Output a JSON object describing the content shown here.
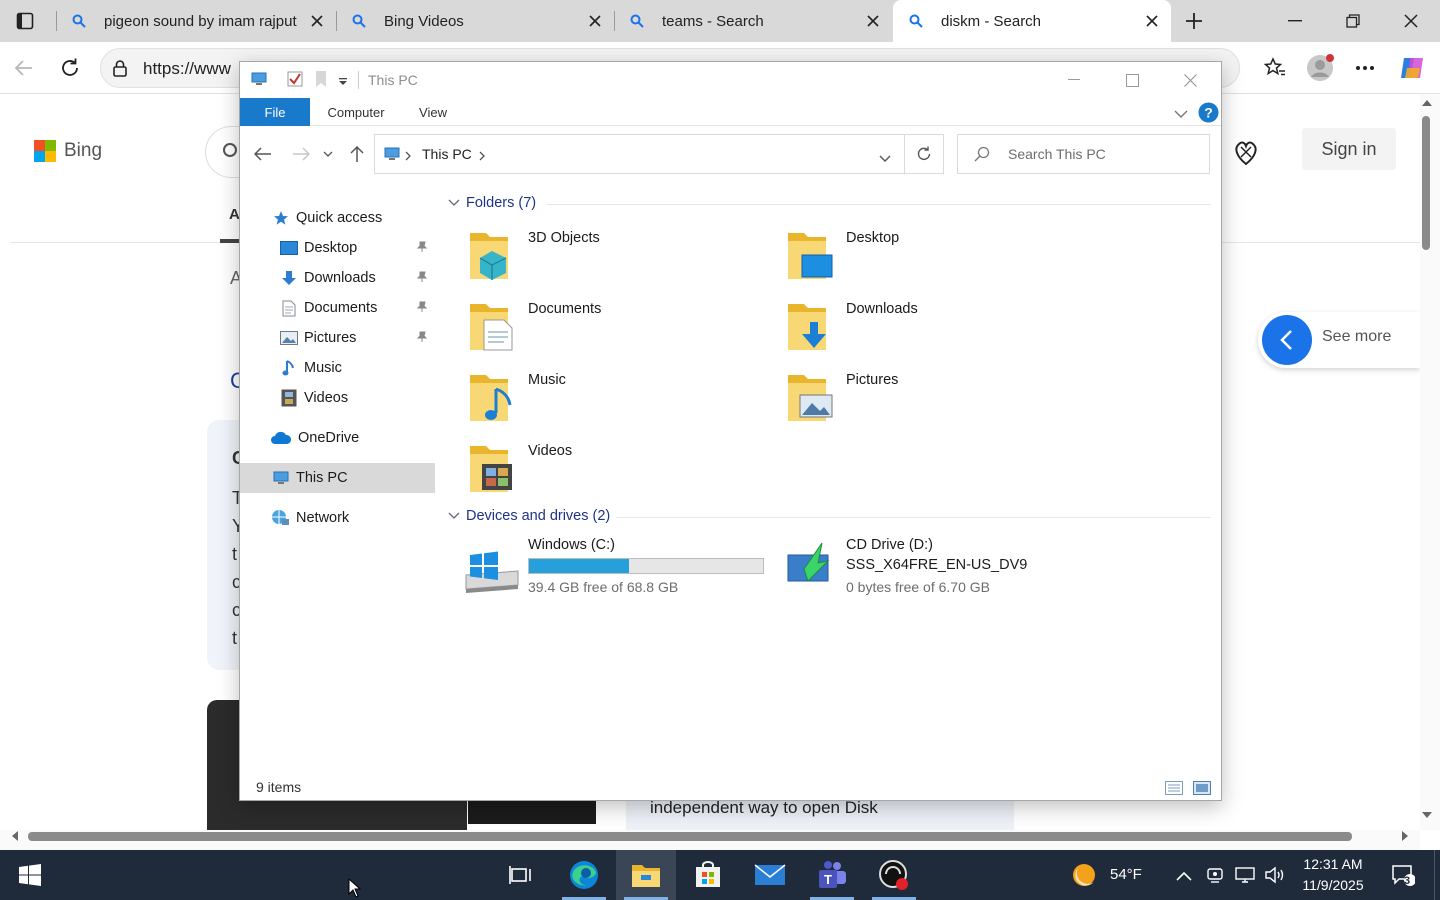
{
  "browser": {
    "tabs": [
      {
        "title": "pigeon sound by imam rajput",
        "active": false
      },
      {
        "title": "Bing Videos",
        "active": false
      },
      {
        "title": "teams - Search",
        "active": false
      },
      {
        "title": "diskm - Search",
        "active": true
      }
    ],
    "address": "https://www",
    "accent": "#1a73e8"
  },
  "bing": {
    "logo_text": "Bing",
    "sign_in": "Sign in",
    "see_more": "See more",
    "partial_letters": [
      "A",
      "A",
      "C",
      "C",
      "T",
      "Y",
      "t",
      "c",
      "c",
      "t"
    ],
    "card_text": "independent way to open Disk"
  },
  "explorer": {
    "title": "This PC",
    "ribbon_tabs": [
      "File",
      "Computer",
      "View"
    ],
    "breadcrumb": "This PC",
    "search_placeholder": "Search This PC",
    "nav": {
      "quick_access": "Quick access",
      "items": [
        "Desktop",
        "Downloads",
        "Documents",
        "Pictures",
        "Music",
        "Videos"
      ],
      "onedrive": "OneDrive",
      "this_pc": "This PC",
      "network": "Network"
    },
    "folders_header": "Folders (7)",
    "folders": [
      "3D Objects",
      "Desktop",
      "Documents",
      "Downloads",
      "Music",
      "Pictures",
      "Videos"
    ],
    "drives_header": "Devices and drives (2)",
    "drives": [
      {
        "name": "Windows (C:)",
        "free": "39.4 GB free of 68.8 GB",
        "used_fraction": 0.427
      },
      {
        "name": "CD Drive (D:)",
        "label": "SSS_X64FRE_EN-US_DV9",
        "free": "0 bytes free of 6.70 GB"
      }
    ],
    "status": "9 items",
    "accent": "#1979ca"
  },
  "taskbar": {
    "weather": "54°F",
    "time": "12:31 AM",
    "date": "11/9/2025",
    "notifications": "3"
  }
}
